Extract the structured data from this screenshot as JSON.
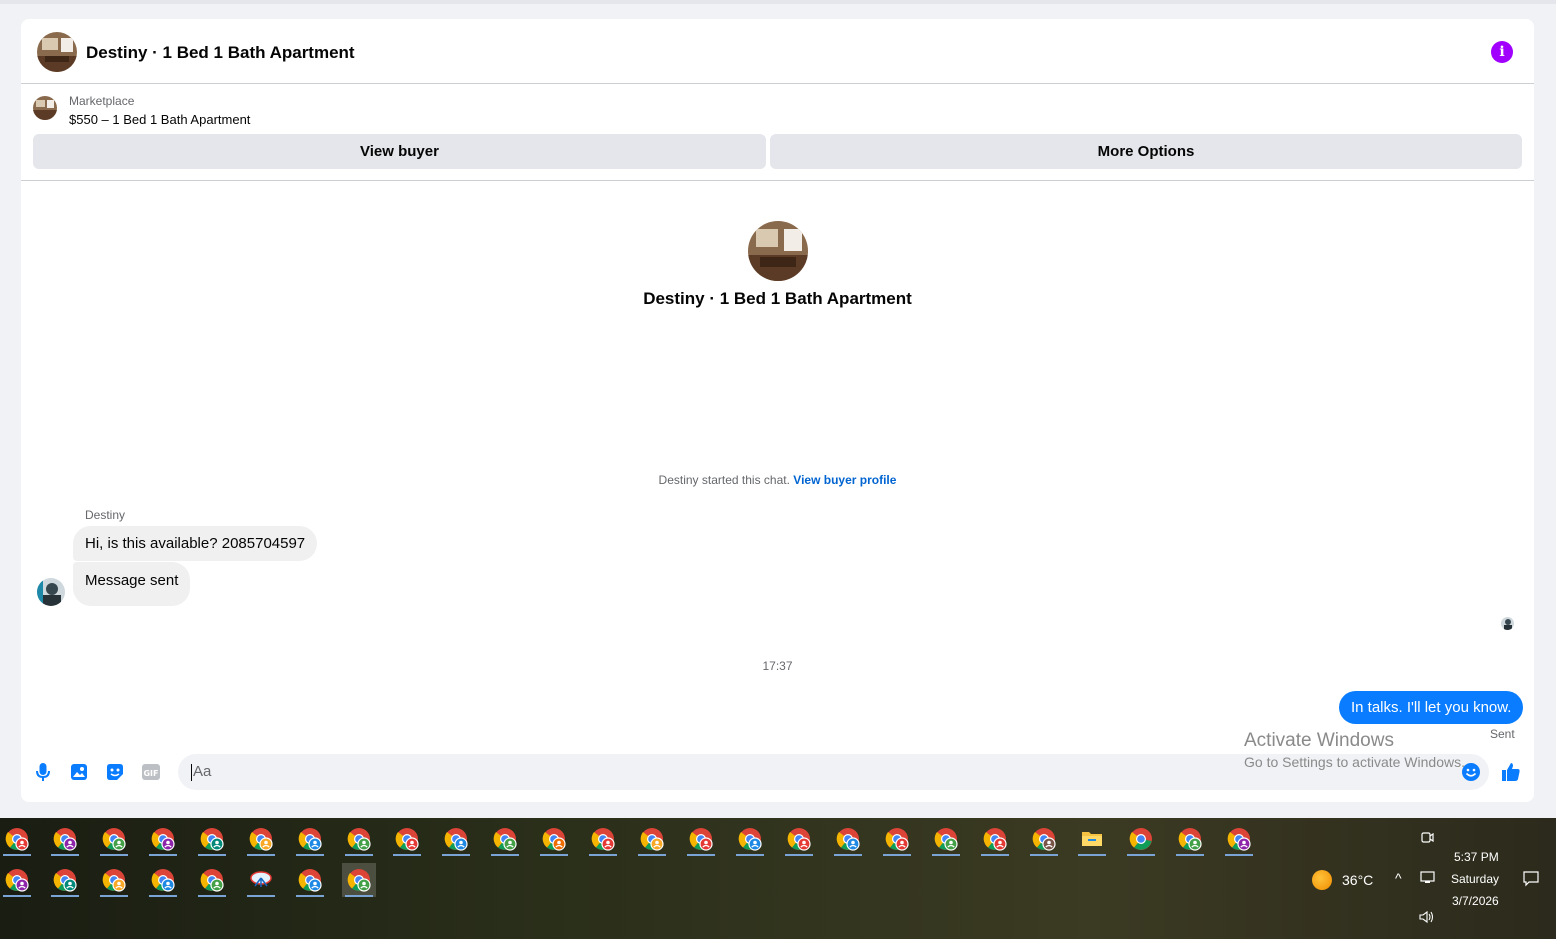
{
  "header": {
    "title": "Destiny · 1 Bed 1 Bath Apartment"
  },
  "marketplace": {
    "label": "Marketplace",
    "listing": "$550 – 1 Bed 1 Bath Apartment"
  },
  "buttons": {
    "view_buyer": "View buyer",
    "more_options": "More Options"
  },
  "chat_intro": {
    "title": "Destiny · 1 Bed 1 Bath Apartment",
    "started_text": "Destiny started this chat.",
    "profile_link": "View buyer profile"
  },
  "messages": {
    "sender_name": "Destiny",
    "incoming": [
      "Hi, is this available? 2085704597",
      "Message sent"
    ],
    "timestamp": "17:37",
    "outgoing": "In talks. I'll let you know.",
    "status": "Sent"
  },
  "composer": {
    "placeholder": "Aa"
  },
  "watermark": {
    "line1": "Activate Windows",
    "line2": "Go to Settings to activate Windows."
  },
  "taskbar": {
    "weather": "36°C",
    "time": "5:37 PM",
    "day": "Saturday",
    "date": "3/7/2026"
  },
  "colors": {
    "accent_blue": "#0a7cff",
    "link_blue": "#0064d1",
    "info_purple": "#a100ff"
  },
  "icons": [
    "microphone-icon",
    "image-icon",
    "sticker-icon",
    "gif-icon",
    "emoji-icon",
    "thumbs-up-icon",
    "info-icon"
  ]
}
